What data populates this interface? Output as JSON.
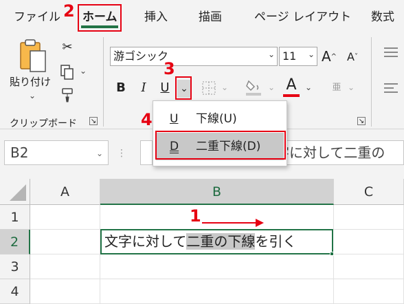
{
  "tabs": [
    {
      "label": "ファイル"
    },
    {
      "label": "ホーム"
    },
    {
      "label": "挿入"
    },
    {
      "label": "描画"
    },
    {
      "label": "ページ レイアウト"
    },
    {
      "label": "数式"
    }
  ],
  "ribbon": {
    "paste_label": "貼り付け",
    "clipboard_group": "クリップボード",
    "font_name": "游ゴシック",
    "font_size": "11",
    "bold": "B",
    "italic": "I",
    "underline": "U",
    "font_color_glyph": "A",
    "grow_glyph": "A",
    "shrink_glyph": "A",
    "phonetic_glyph": "亜"
  },
  "underline_menu": {
    "items": [
      {
        "icon": "U",
        "label": "下線(U)"
      },
      {
        "icon": "D",
        "label": "二重下線(D)"
      }
    ]
  },
  "formula_bar": {
    "name_box": "B2",
    "content": "文字に対して二重の"
  },
  "grid": {
    "columns": [
      "A",
      "B",
      "C"
    ],
    "rows": [
      "1",
      "2",
      "3",
      "4"
    ],
    "cell_b2": {
      "before": "文字に対して",
      "highlighted": "二重の下線",
      "after": "を引く"
    }
  },
  "annotations": {
    "step1": "1",
    "step2": "2",
    "step3": "3",
    "step4": "4"
  },
  "colors": {
    "accent": "#217346",
    "annotation": "#e60012",
    "font_color_bar": "#e60012"
  }
}
